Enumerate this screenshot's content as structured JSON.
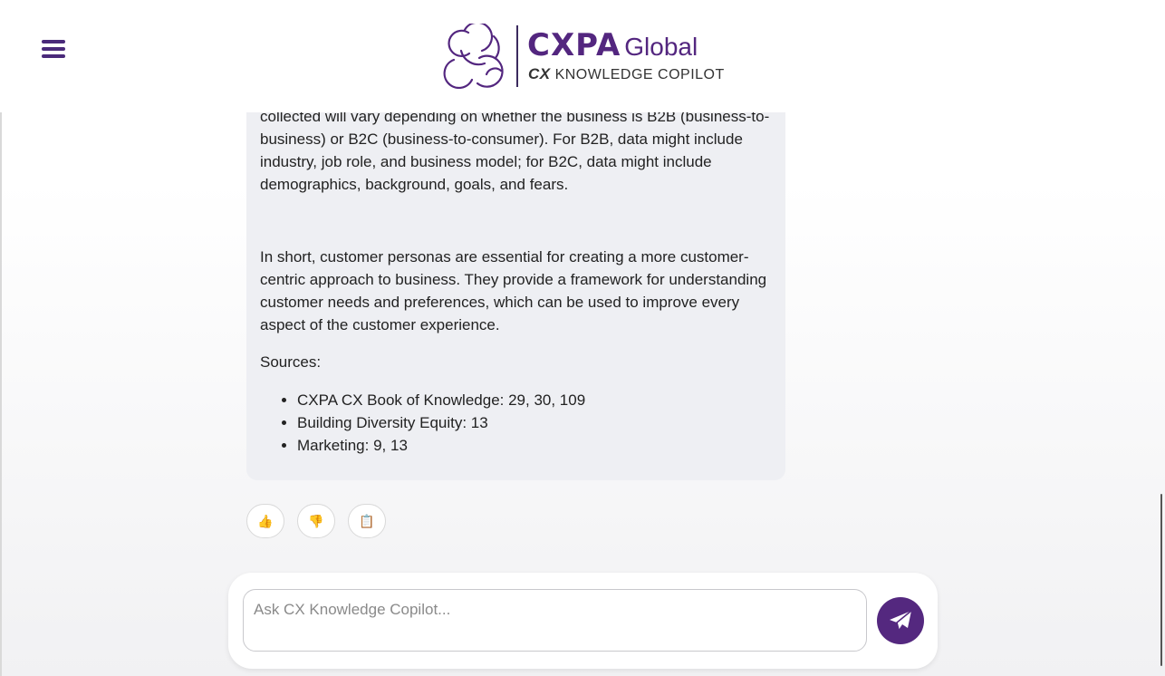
{
  "header": {
    "menu_icon": "hamburger-menu-icon",
    "logo": {
      "brand": "CXPA",
      "brand_suffix": "Global",
      "subtitle_cx": "CX",
      "subtitle_rest": "KNOWLEDGE COPILOT",
      "color": "#53267f"
    }
  },
  "message": {
    "line_partial": "interviews with employees who interact with customers. The type of data collected will vary depending on whether the business is B2B (business-to-business) or B2C (business-to-consumer). For B2B, data might include industry, job role, and business model; for B2C, data might include demographics, background, goals, and fears.",
    "paragraph_2": "In short, customer personas are essential for creating a more customer-centric approach to business. They provide a framework for understanding customer needs and preferences, which can be used to improve every aspect of the customer experience.",
    "sources_label": "Sources:",
    "sources": [
      "CXPA CX Book of Knowledge: 29, 30, 109",
      "Building Diversity Equity: 13",
      "Marketing: 9, 13"
    ]
  },
  "actions": {
    "thumbs_up": "👍",
    "thumbs_down": "👎",
    "copy": "📋"
  },
  "composer": {
    "placeholder": "Ask CX Knowledge Copilot...",
    "send_icon": "paper-plane-icon",
    "accent": "#54287f"
  }
}
